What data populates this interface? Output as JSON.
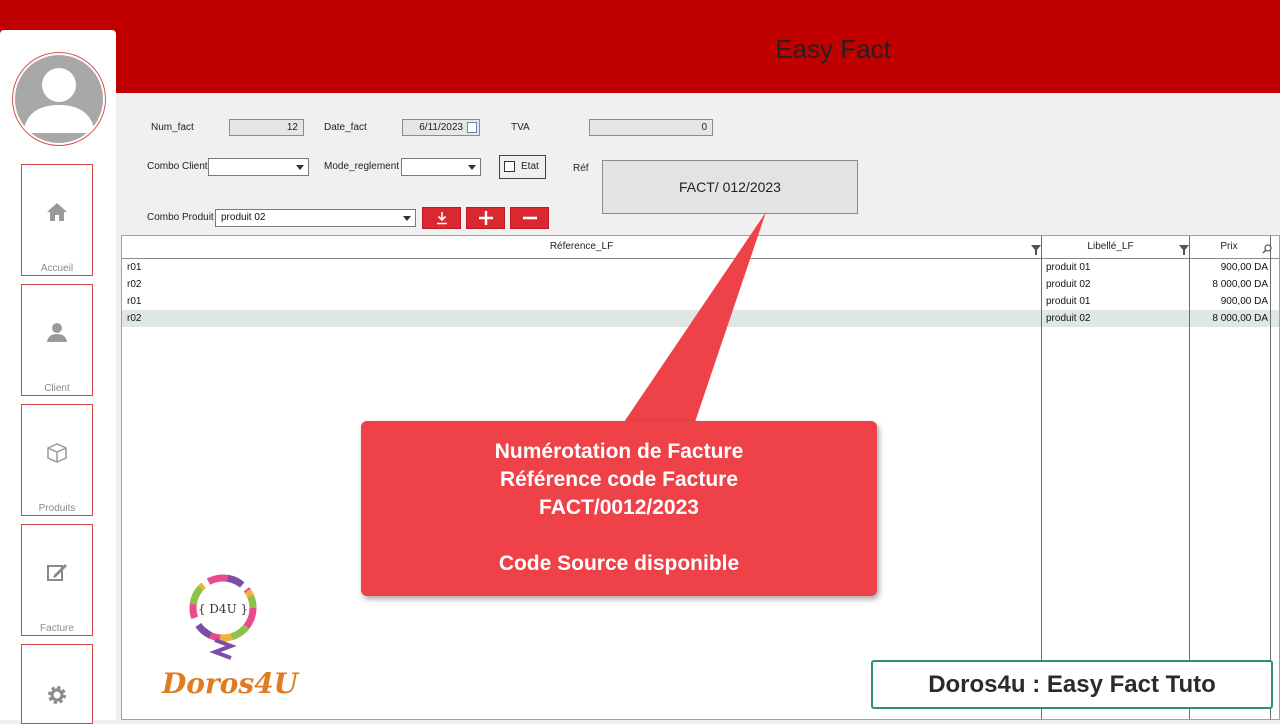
{
  "app": {
    "title": "Easy Fact"
  },
  "sidebar": {
    "items": [
      {
        "label": "Accueil",
        "icon": "home-icon"
      },
      {
        "label": "Client",
        "icon": "user-icon"
      },
      {
        "label": "Produits",
        "icon": "box-icon"
      },
      {
        "label": "Facture",
        "icon": "edit-icon"
      },
      {
        "label": "",
        "icon": "gear-icon"
      }
    ]
  },
  "form": {
    "num_fact_label": "Num_fact",
    "num_fact_value": "12",
    "date_fact_label": "Date_fact",
    "date_fact_value": "6/11/2023",
    "tva_label": "TVA",
    "tva_value": "0",
    "combo_client_label": "Combo Client",
    "combo_client_value": "",
    "mode_reglement_label": "Mode_reglement",
    "mode_reglement_value": "",
    "etat_label": "Etat",
    "etat_checked": false,
    "ref_label": "Réf",
    "ref_value": "FACT/ 012/2023",
    "combo_produit_label": "Combo Produit",
    "combo_produit_value": "produit 02"
  },
  "table": {
    "columns": [
      "Réference_LF",
      "Libellé_LF",
      "Prix"
    ],
    "rows": [
      {
        "ref": "r01",
        "libelle": "produit 01",
        "prix": "900,00 DA"
      },
      {
        "ref": "r02",
        "libelle": "produit 02",
        "prix": "8 000,00 DA"
      },
      {
        "ref": "r01",
        "libelle": "produit 01",
        "prix": "900,00 DA"
      },
      {
        "ref": "r02",
        "libelle": "produit 02",
        "prix": "8 000,00 DA"
      }
    ],
    "selected_row": 3
  },
  "callout": {
    "lines": [
      "Numérotation de Facture",
      "Référence code Facture",
      "FACT/0012/2023",
      "",
      "Code Source disponible"
    ],
    "color": "#ee4148"
  },
  "badge": {
    "text": "Doros4u : Easy Fact Tuto"
  },
  "logo": {
    "text": "Doros4U",
    "mark": "{ D4U }"
  },
  "colors": {
    "header": "#c00000",
    "accent": "#d9282f",
    "badge_border": "#2f8f7d"
  }
}
